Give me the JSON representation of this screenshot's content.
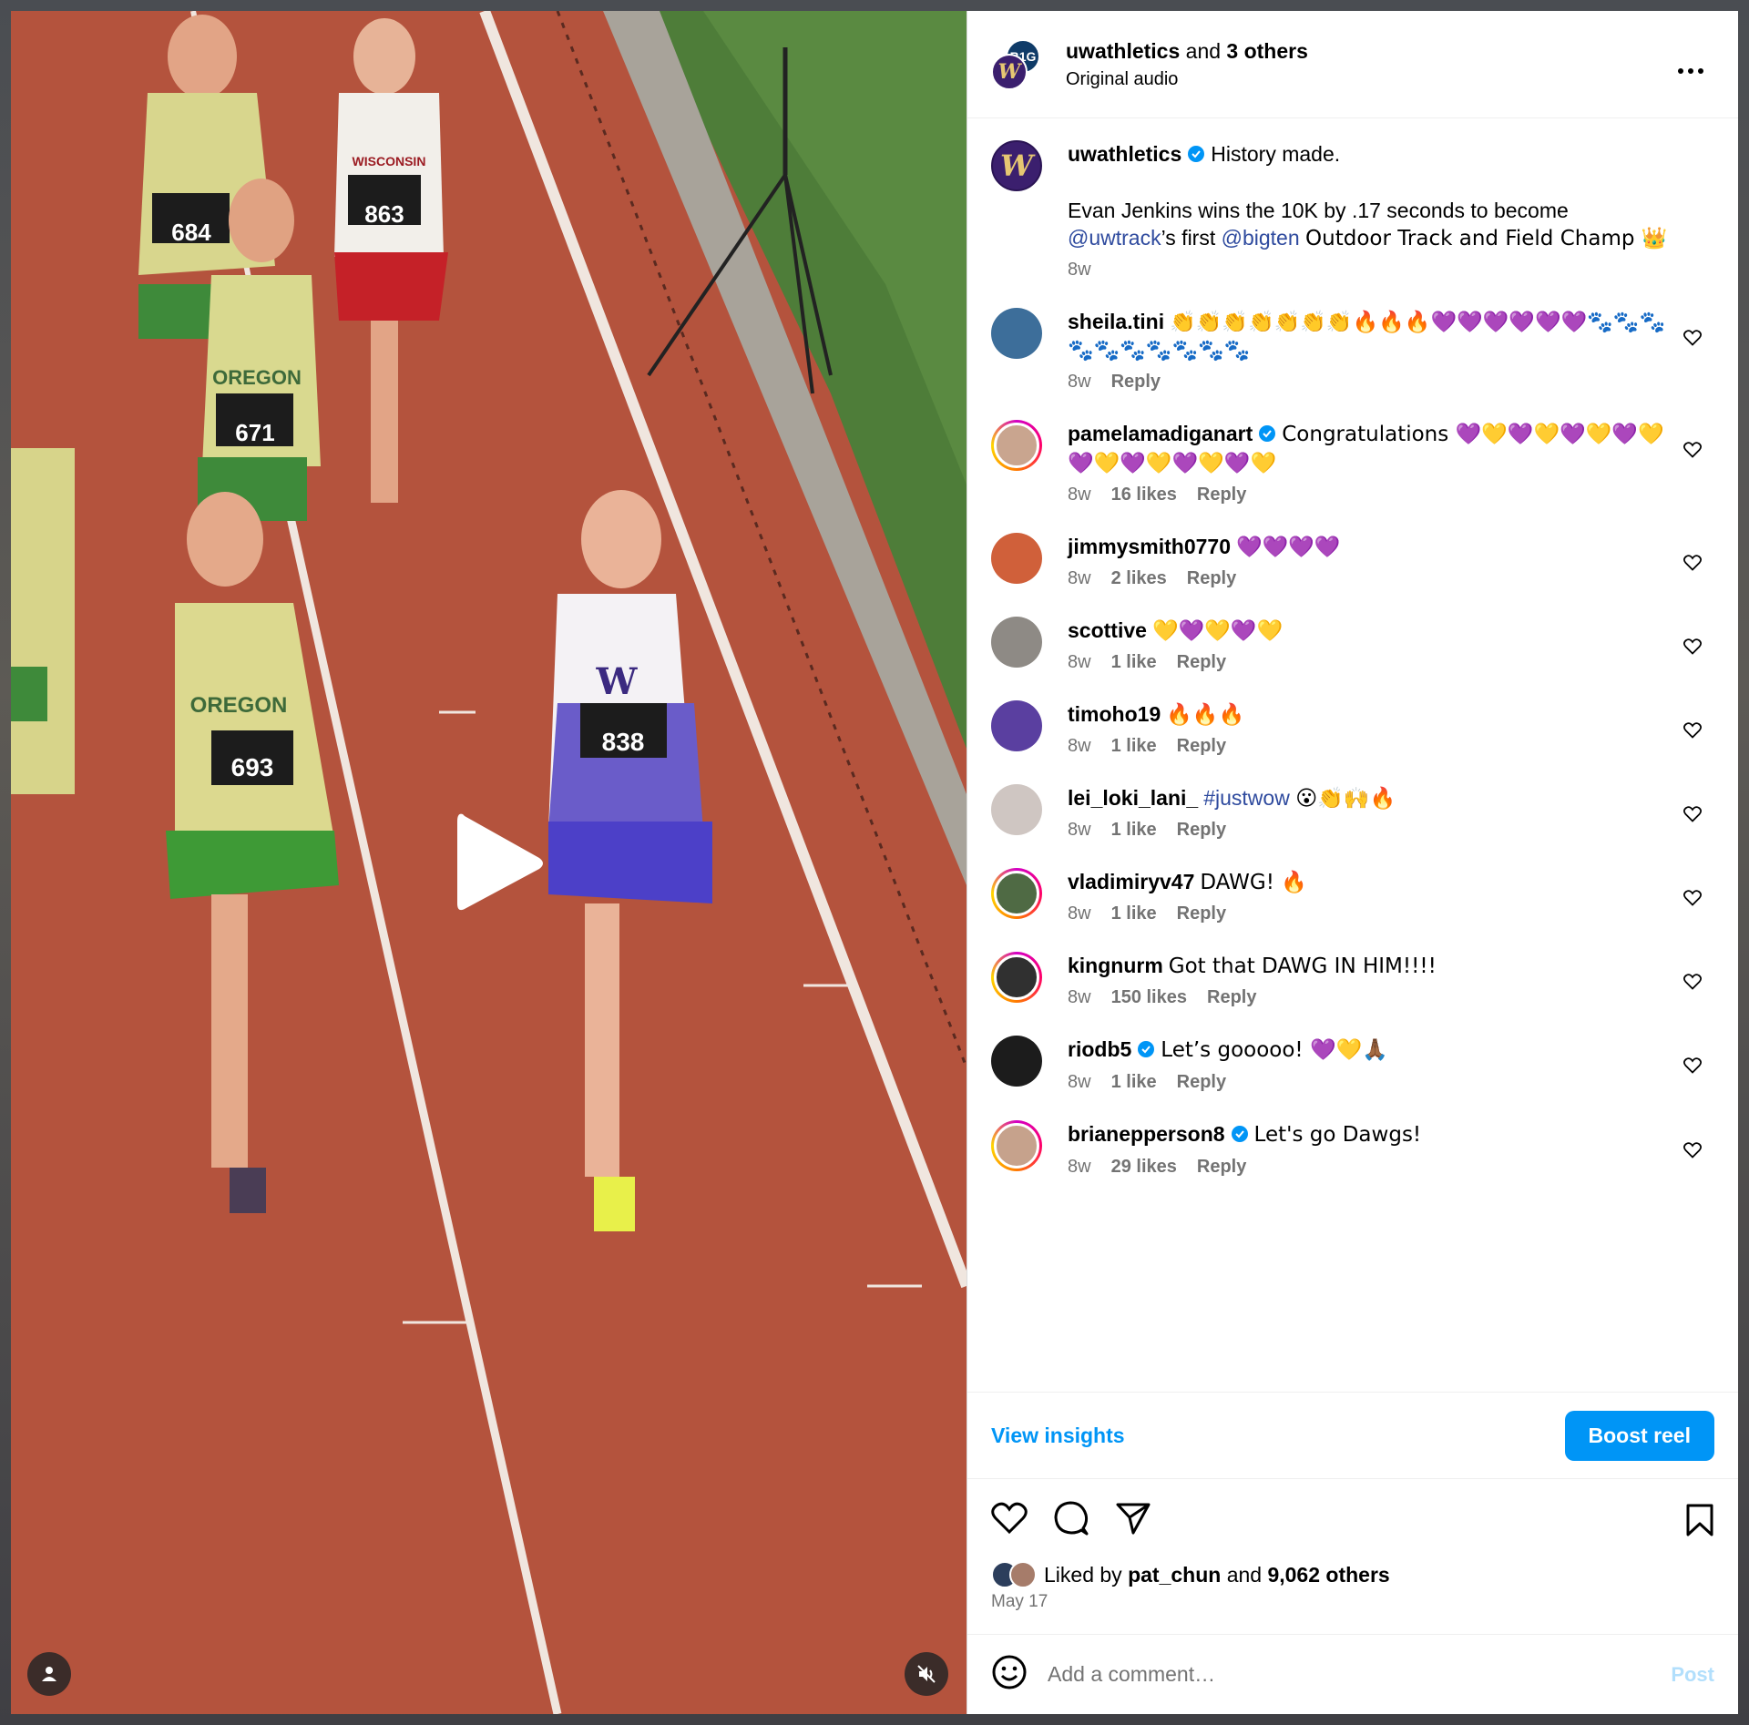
{
  "colors": {
    "accent": "#0095f6",
    "link": "#2e4a9e",
    "secondary": "#737373",
    "track": "#b4533d"
  },
  "header": {
    "account": "uwathletics",
    "and_text": "and",
    "others": "3 others",
    "audio": "Original audio",
    "avatar_letter": "W"
  },
  "caption": {
    "username": "uwathletics",
    "line1": "History made.",
    "line2_pre": "Evan Jenkins wins the 10K by .17 seconds to become",
    "mention1": "@uwtrack",
    "mid": "’s first",
    "mention2": "@bigten",
    "line2_post": "Outdoor Track and Field Champ 👑",
    "time": "8w"
  },
  "comments": [
    {
      "username": "sheila.tini",
      "verified": false,
      "text": "👏👏👏👏👏👏👏🔥🔥🔥💜💜💜💜💜💜🐾🐾🐾🐾🐾🐾🐾🐾🐾🐾",
      "time": "8w",
      "likes": "",
      "reply": "Reply"
    },
    {
      "username": "pamelamadiganart",
      "verified": true,
      "text": "Congratulations 💜💛💜💛💜💛💜💛💜💛💜💛💜💛💜💛",
      "time": "8w",
      "likes": "16 likes",
      "reply": "Reply"
    },
    {
      "username": "jimmysmith0770",
      "verified": false,
      "text": "💜💜💜💜",
      "time": "8w",
      "likes": "2 likes",
      "reply": "Reply"
    },
    {
      "username": "scottive",
      "verified": false,
      "text": "💛💜💛💜💛",
      "time": "8w",
      "likes": "1 like",
      "reply": "Reply"
    },
    {
      "username": "timoho19",
      "verified": false,
      "text": "🔥🔥🔥",
      "time": "8w",
      "likes": "1 like",
      "reply": "Reply"
    },
    {
      "username": "lei_loki_lani_",
      "verified": false,
      "hashtag": "#justwow",
      "text": "😮👏🙌🔥",
      "time": "8w",
      "likes": "1 like",
      "reply": "Reply"
    },
    {
      "username": "vladimiryv47",
      "verified": false,
      "text": "DAWG! 🔥",
      "time": "8w",
      "likes": "1 like",
      "reply": "Reply"
    },
    {
      "username": "kingnurm",
      "verified": false,
      "text": "Got that DAWG IN HIM!!!!",
      "time": "8w",
      "likes": "150 likes",
      "reply": "Reply"
    },
    {
      "username": "riodb5",
      "verified": true,
      "text": "Let’s gooooo! 💜💛🙏🏾",
      "time": "8w",
      "likes": "1 like",
      "reply": "Reply"
    },
    {
      "username": "brianepperson8",
      "verified": true,
      "text": "Let's go Dawgs!",
      "time": "8w",
      "likes": "29 likes",
      "reply": "Reply"
    }
  ],
  "insights": {
    "view": "View insights",
    "boost": "Boost reel"
  },
  "likes": {
    "prefix": "Liked by",
    "user": "pat_chun",
    "and": "and",
    "count": "9,062 others"
  },
  "date": "May 17",
  "composer": {
    "placeholder": "Add a comment…",
    "post": "Post"
  },
  "video": {
    "bibs": [
      "684",
      "863",
      "671",
      "693",
      "838"
    ],
    "jersey_text": [
      "OREGON",
      "WISCONSIN",
      "OREGON",
      "OREGON",
      "W"
    ]
  },
  "icons": [
    "more-icon",
    "heart-icon",
    "comment-icon",
    "share-icon",
    "bookmark-icon",
    "emoji-icon",
    "play-icon",
    "user-icon",
    "mute-icon",
    "verified-icon"
  ]
}
